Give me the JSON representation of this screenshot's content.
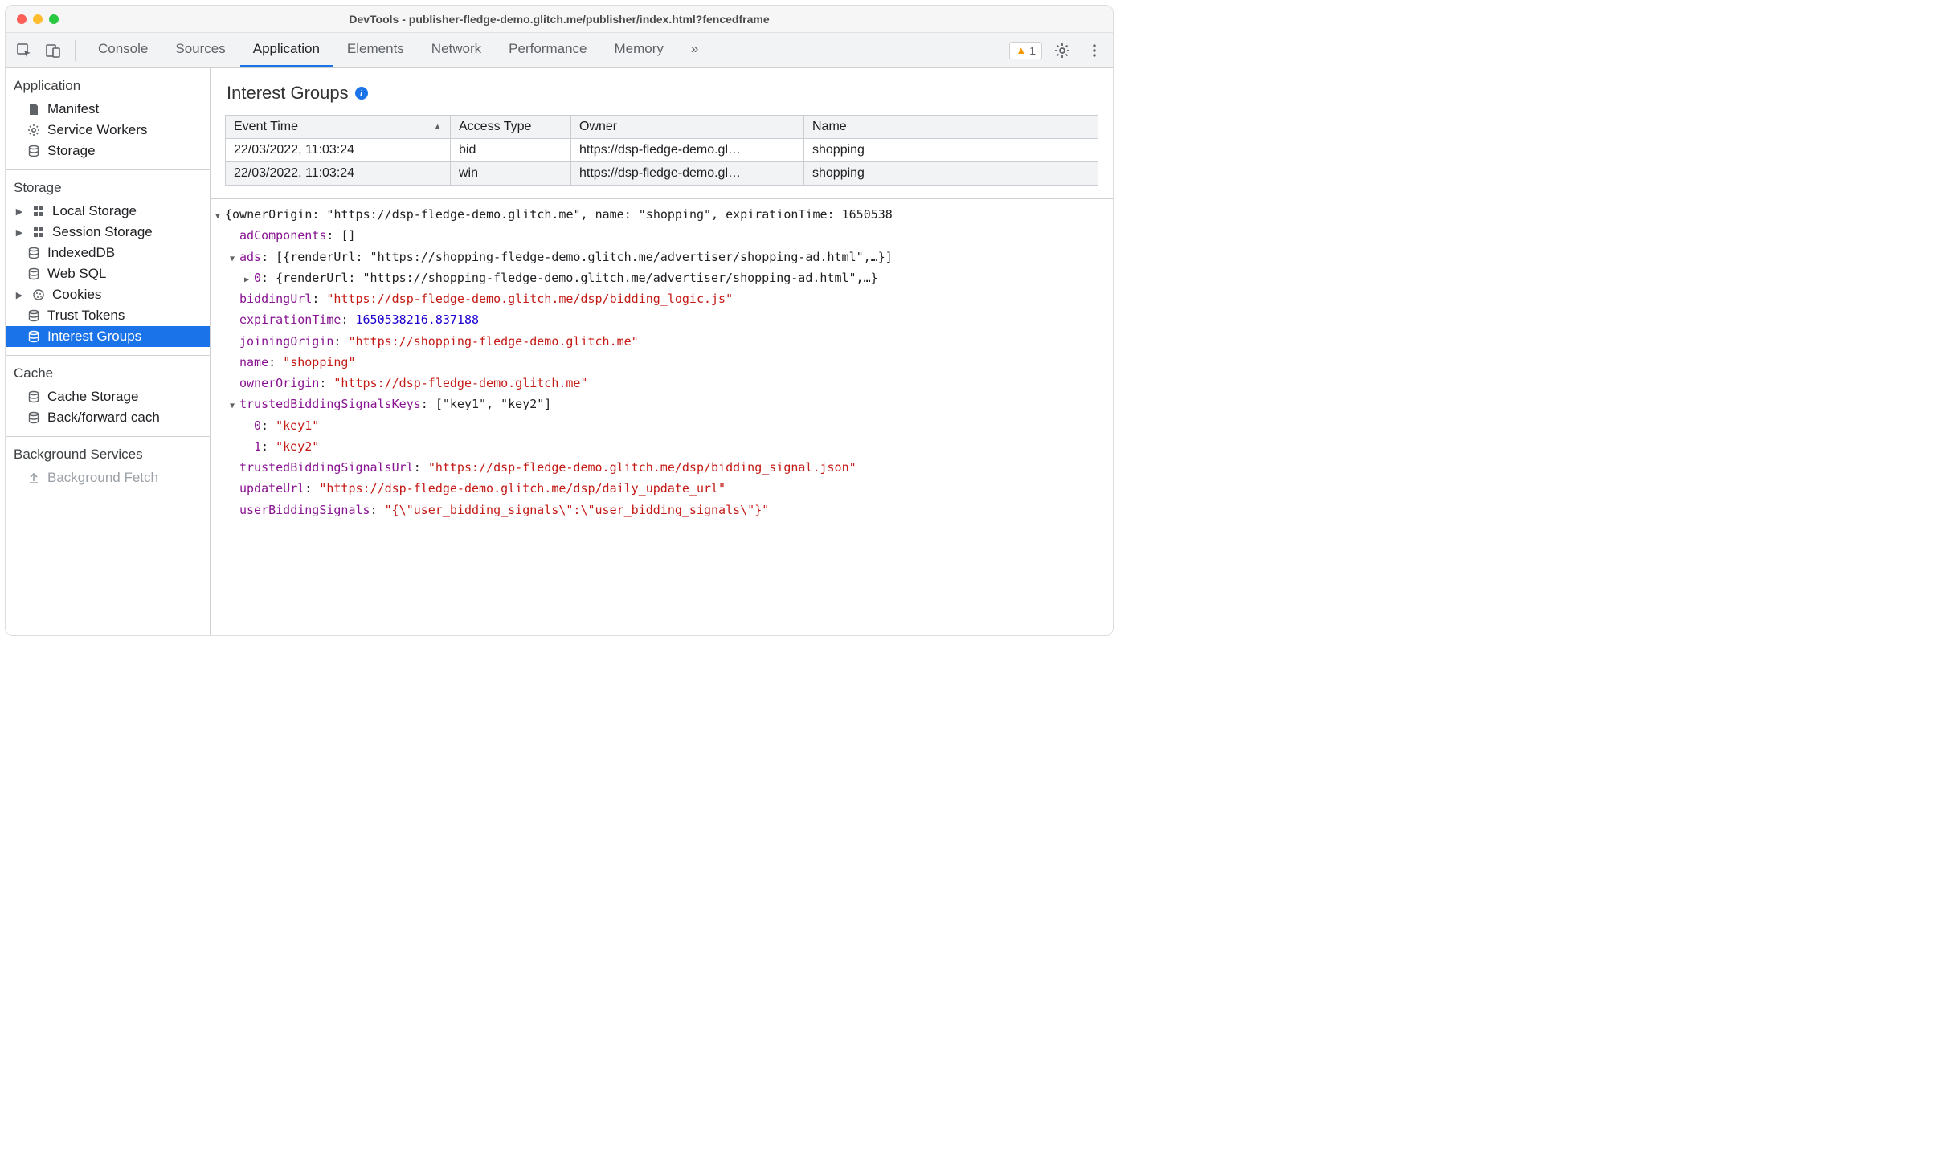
{
  "window": {
    "title": "DevTools - publisher-fledge-demo.glitch.me/publisher/index.html?fencedframe"
  },
  "toolbar": {
    "tabs": [
      "Console",
      "Sources",
      "Application",
      "Elements",
      "Network",
      "Performance",
      "Memory"
    ],
    "activeTab": "Application",
    "moreTabsGlyph": "»",
    "warningCount": "1"
  },
  "sidebar": {
    "sections": {
      "application": {
        "heading": "Application",
        "items": [
          "Manifest",
          "Service Workers",
          "Storage"
        ]
      },
      "storage": {
        "heading": "Storage",
        "items": [
          "Local Storage",
          "Session Storage",
          "IndexedDB",
          "Web SQL",
          "Cookies",
          "Trust Tokens",
          "Interest Groups"
        ]
      },
      "cache": {
        "heading": "Cache",
        "items": [
          "Cache Storage",
          "Back/forward cach"
        ]
      },
      "background": {
        "heading": "Background Services",
        "items": [
          "Background Fetch"
        ]
      }
    },
    "selected": "Interest Groups"
  },
  "panel": {
    "title": "Interest Groups",
    "table": {
      "columns": [
        "Event Time",
        "Access Type",
        "Owner",
        "Name"
      ],
      "rows": [
        {
          "time": "22/03/2022, 11:03:24",
          "type": "bid",
          "owner": "https://dsp-fledge-demo.gl…",
          "name": "shopping"
        },
        {
          "time": "22/03/2022, 11:03:24",
          "type": "win",
          "owner": "https://dsp-fledge-demo.gl…",
          "name": "shopping"
        }
      ]
    },
    "detail": {
      "summary": "{ownerOrigin: \"https://dsp-fledge-demo.glitch.me\", name: \"shopping\", expirationTime: 1650538",
      "adComponents": "[]",
      "adsSummary": "[{renderUrl: \"https://shopping-fledge-demo.glitch.me/advertiser/shopping-ad.html\",…}]",
      "ads0Summary": "{renderUrl: \"https://shopping-fledge-demo.glitch.me/advertiser/shopping-ad.html\",…}",
      "biddingUrl": "\"https://dsp-fledge-demo.glitch.me/dsp/bidding_logic.js\"",
      "expirationTime": "1650538216.837188",
      "joiningOrigin": "\"https://shopping-fledge-demo.glitch.me\"",
      "name": "\"shopping\"",
      "ownerOrigin": "\"https://dsp-fledge-demo.glitch.me\"",
      "trustedKeysSummary": "[\"key1\", \"key2\"]",
      "trustedKey0": "\"key1\"",
      "trustedKey1": "\"key2\"",
      "trustedBiddingSignalsUrl": "\"https://dsp-fledge-demo.glitch.me/dsp/bidding_signal.json\"",
      "updateUrl": "\"https://dsp-fledge-demo.glitch.me/dsp/daily_update_url\"",
      "userBiddingSignals": "\"{\\\"user_bidding_signals\\\":\\\"user_bidding_signals\\\"}\""
    }
  }
}
